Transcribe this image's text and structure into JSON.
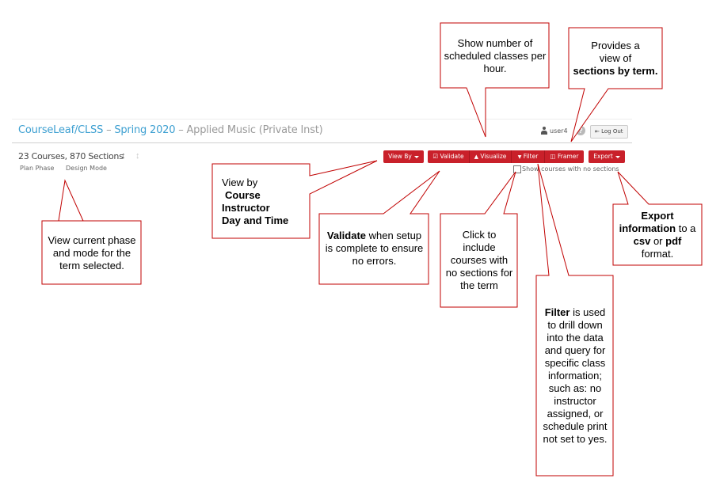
{
  "header": {
    "app_link": "CourseLeaf/CLSS",
    "separator1": " – ",
    "term": "Spring 2020",
    "separator2": " – ",
    "department": "Applied Music (Private Inst)",
    "username": "user4",
    "help_symbol": "?",
    "logout_label": "Log Out",
    "logout_icon": "logout-icon",
    "user_icon": "user-icon"
  },
  "summary": {
    "counts": "23 Courses, 870 Sections",
    "phase": "Plan Phase",
    "mode": "Design Mode",
    "sort_icon_active": "↕",
    "sort_icon_inactive": "↕"
  },
  "toolbar": {
    "view_by": "View By",
    "validate": "Validate",
    "visualize": "Visualize",
    "filter": "Filter",
    "framer": "Framer",
    "export": "Export",
    "validate_icon": "☑",
    "visualize_icon": "🔥",
    "filter_icon": "▼",
    "framer_icon": "◫",
    "show_no_sections_label": "Show courses with no sections",
    "show_no_sections_checked": false
  },
  "callouts": {
    "visualize": {
      "text": "Show number of scheduled classes per hour."
    },
    "framer": {
      "line1": "Provides a",
      "line2": "view of",
      "bold": "sections by term."
    },
    "phase": {
      "text": "View current phase and mode for the term selected."
    },
    "viewby": {
      "line1": "View by",
      "options": [
        "Course",
        "Instructor",
        "Day and Time"
      ]
    },
    "validate": {
      "bold": "Validate",
      "text": " when setup is complete to ensure no errors."
    },
    "checkbox": {
      "text": "Click to include courses with no sections for the term"
    },
    "filter": {
      "bold": "Filter",
      "text": " is used to drill down into the data and query for specific class information; such as: no instructor assigned, or schedule print not set to yes."
    },
    "export": {
      "bold1": "Export information",
      "text1": " to a ",
      "bold2": "csv",
      "text2": " or ",
      "bold3": "pdf",
      "text3": " format."
    }
  },
  "colors": {
    "brand_red": "#c9202a",
    "link_blue": "#3c9fd1",
    "callout_border": "#c00000"
  }
}
